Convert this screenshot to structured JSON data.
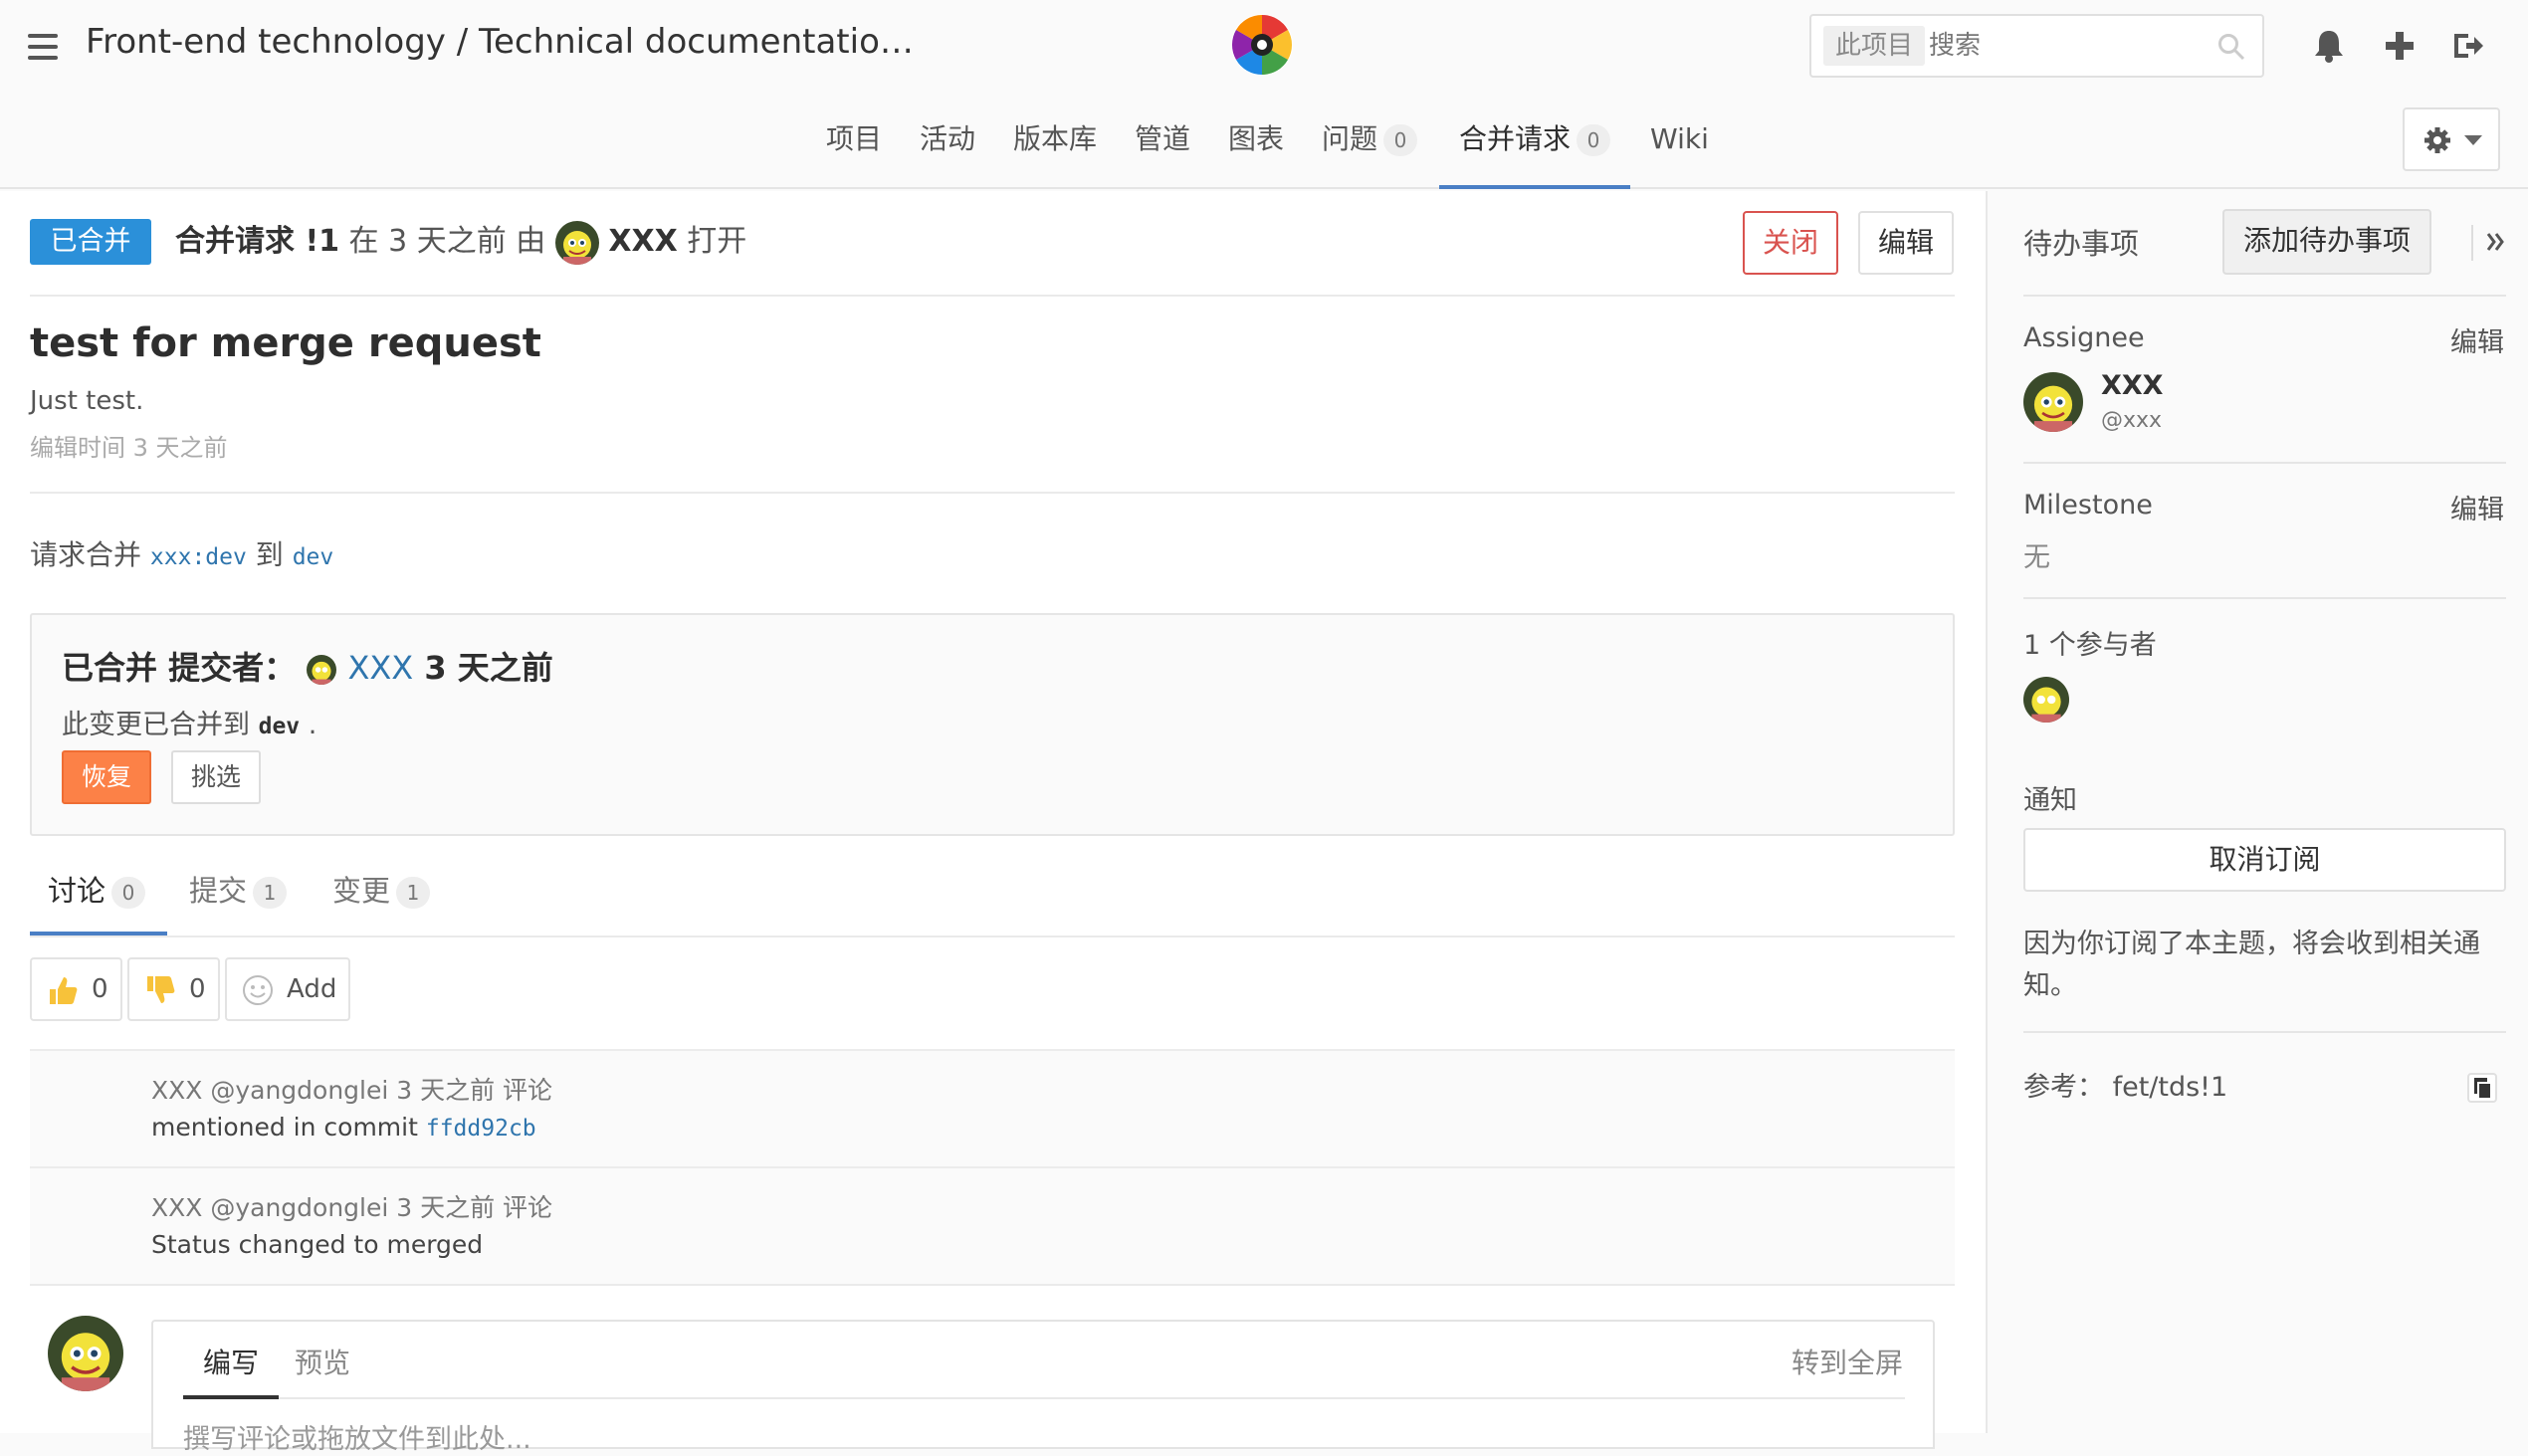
{
  "header": {
    "breadcrumb": "Front-end technology / Technical documentatio…",
    "search_scope": "此项目",
    "search_placeholder": "搜索"
  },
  "nav": {
    "tabs": [
      {
        "label": "项目"
      },
      {
        "label": "活动"
      },
      {
        "label": "版本库"
      },
      {
        "label": "管道"
      },
      {
        "label": "图表"
      },
      {
        "label": "问题",
        "count": "0"
      },
      {
        "label": "合并请求",
        "count": "0",
        "active": true
      },
      {
        "label": "Wiki"
      }
    ]
  },
  "mr": {
    "status": "已合并",
    "ref": "合并请求 !1",
    "time_prefix": "在",
    "time": "3 天之前",
    "by": "由",
    "author": "XXX",
    "action": "打开",
    "close_label": "关闭",
    "edit_label": "编辑",
    "title": "test for merge request",
    "description": "Just test.",
    "edited": "编辑时间 3 天之前",
    "request_prefix": "请求合并",
    "source_branch": "xxx:dev",
    "to": "到",
    "target_branch": "dev"
  },
  "merged_widget": {
    "title": "已合并 提交者：",
    "committer": "XXX",
    "time": "3 天之前",
    "text_prefix": "此变更已合并到",
    "branch": "dev",
    "text_suffix": ".",
    "revert_label": "恢复",
    "cherry_pick_label": "挑选"
  },
  "sub_tabs": [
    {
      "label": "讨论",
      "count": "0"
    },
    {
      "label": "提交",
      "count": "1"
    },
    {
      "label": "变更",
      "count": "1"
    }
  ],
  "reactions": {
    "thumbs_up": "0",
    "thumbs_down": "0",
    "add_label": "Add"
  },
  "notes": [
    {
      "meta": "XXX @yangdonglei 3 天之前 评论",
      "body": "mentioned in commit",
      "commit": "ffdd92cb"
    },
    {
      "meta": "XXX @yangdonglei 3 天之前 评论",
      "body": "Status changed to merged"
    }
  ],
  "editor": {
    "write_tab": "编写",
    "preview_tab": "预览",
    "fullscreen": "转到全屏",
    "placeholder": "撰写评论或拖放文件到此处..."
  },
  "sidebar": {
    "todo_label": "待办事项",
    "add_todo_label": "添加待办事项",
    "assignee_label": "Assignee",
    "edit_label": "编辑",
    "assignee_name": "XXX",
    "assignee_username": "@xxx",
    "milestone_label": "Milestone",
    "milestone_value": "无",
    "participants_label": "1 个参与者",
    "notifications_label": "通知",
    "unsubscribe_label": "取消订阅",
    "subscribe_note_line1": "因为你订阅了本主题，将会收到相关通",
    "subscribe_note_line2": "知。",
    "reference_label": "参考：",
    "reference_value": "fet/tds!1"
  },
  "colors": {
    "accent": "#2b90d9",
    "tab_underline": "#4a7fc5",
    "revert": "#fc8147",
    "close": "#d9534f"
  }
}
